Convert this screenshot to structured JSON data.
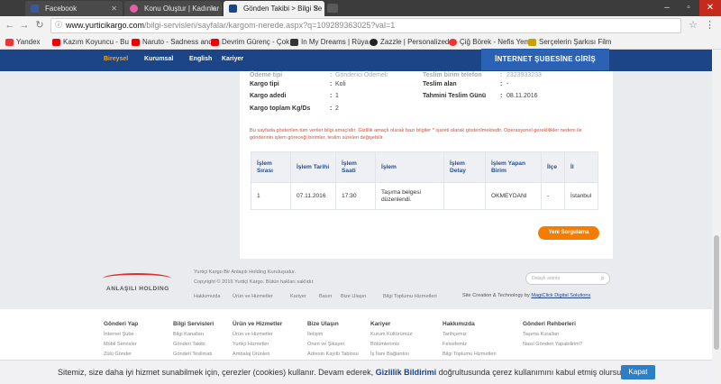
{
  "browser": {
    "tabs": [
      {
        "label": "Facebook",
        "color": "#3b5998"
      },
      {
        "label": "Konu Oluştur | Kadınlar K",
        "color": "#e35ea4"
      },
      {
        "label": "Gönden Takibi > Bilgi Se",
        "color": "#1b4587"
      }
    ],
    "url_host": "www.yurticikargo.com",
    "url_path": "/bilgi-servisleri/sayfalar/kargom-nerede.aspx?q=109289363025?val=1",
    "bookmarks": [
      "Yandex",
      "Kazım Koyuncu - Bu",
      "Naruto - Sadness and",
      "Devrim Gürenç - Çok",
      "In My Dreams | Rüya",
      "Zazzle | Personalized",
      "Çiğ Börek - Nefis Yem",
      "Serçelerin Şarkısı Film"
    ]
  },
  "site": {
    "nav": [
      "Bireysel",
      "Kurumsal",
      "English",
      "Kariyer"
    ],
    "branch_button": "İNTERNET ŞUBESİNE GİRİŞ"
  },
  "shipment": {
    "left": [
      {
        "label": "Ödeme tipi",
        "value": "Gönderici Ödemeli"
      },
      {
        "label": "Kargo tipi",
        "value": "Koli"
      },
      {
        "label": "Kargo adedi",
        "value": "1"
      },
      {
        "label": "Kargo toplam Kg/Ds",
        "value": "2"
      }
    ],
    "right": [
      {
        "label": "Teslim birim telefon",
        "value": "2323933233"
      },
      {
        "label": "Teslim alan",
        "value": "-"
      },
      {
        "label": "Tahmini Teslim Günü",
        "value": "08.11.2016"
      }
    ],
    "note": "Bu sayfada gösterilen tüm veriler bilgi amaçlıdır. Gizlilik amaçlı olarak bazı bilgiler * işareti olarak gösterilmektedir. Operasyonel gereklilikler nedeni ile gönderinin işlem göreceği birimler, teslim süreleri değişebilir."
  },
  "table": {
    "headers": [
      "İşlem Sırası",
      "İşlem Tarihi",
      "İşlem Saati",
      "İşlem",
      "İşlem Detay",
      "İşlem Yapan Birim",
      "İlçe",
      "İl"
    ],
    "rows": [
      [
        "1",
        "07.11.2016",
        "17:30",
        "Taşıma belgesi düzenlendi.",
        "",
        "OKMEYDANI",
        "-",
        "İstanbul"
      ]
    ]
  },
  "new_query_button": "Yeni Sorgulama",
  "footer": {
    "company": "Yurtiçi Kargo Bir Anlaşılı Holding Kuruluşudur.",
    "copyright": "Copyright © 2016 Yurtiçi Kargo. Bütün hakları saklıdır.",
    "links": [
      "Hakkımızda",
      "Ürün ve Hizmetler",
      "Kariyer",
      "Basın",
      "Bize Ulaşın",
      "Bilgi Toplumu Hizmetleri"
    ],
    "logo_text": "ANLAŞILI HOLDING",
    "search_placeholder": "Detaylı arama",
    "credit_prefix": "Site Creation & Technology by",
    "credit_link": "MagiClick Digital Solutions"
  },
  "sitemap": [
    {
      "head": "Gönderi Yap",
      "items": [
        "İnternet Şube",
        "Mobil Servisler",
        "Zülü Gönder"
      ]
    },
    {
      "head": "Bilgi Servisleri",
      "items": [
        "Bilgi Kanalları",
        "Gönderi Takibi",
        "Gönderi Teslimatı"
      ]
    },
    {
      "head": "Ürün ve Hizmetler",
      "items": [
        "Ürün ve Hizmetler",
        "Yurtiçi Hizmetler",
        "Ambalaj Ürünleri"
      ]
    },
    {
      "head": "Bize Ulaşın",
      "items": [
        "İletişim",
        "Öneri ve Şikayet",
        "Adresin Kayıtlı Tablosu"
      ]
    },
    {
      "head": "Kariyer",
      "items": [
        "Kurum Kültürümüz",
        "Bölümlerimiz",
        "İş İlanı Bağlantısı"
      ]
    },
    {
      "head": "Hakkımızda",
      "items": [
        "Tarihçemiz",
        "Felsefemiz",
        "Bilgi Toplumu Hizmetleri"
      ]
    },
    {
      "head": "Gönderi Rehberleri",
      "items": [
        "Taşıma Kuralları",
        "Nasıl Gönderi Yapabilirim?"
      ]
    }
  ],
  "cookie": {
    "before": "Sitemiz, size daha iyi hizmet sunabilmek için, çerezler (cookies) kullanır. Devam ederek,",
    "link": "Gizlilik Bildirimi",
    "after": "doğrultusunda çerez kullanımını kabul etmiş olursunuz.",
    "button": "Kapat"
  },
  "colors": {
    "brand_blue": "#1b4587",
    "accent_orange": "#f47c00",
    "note_red": "#e04a2e"
  }
}
